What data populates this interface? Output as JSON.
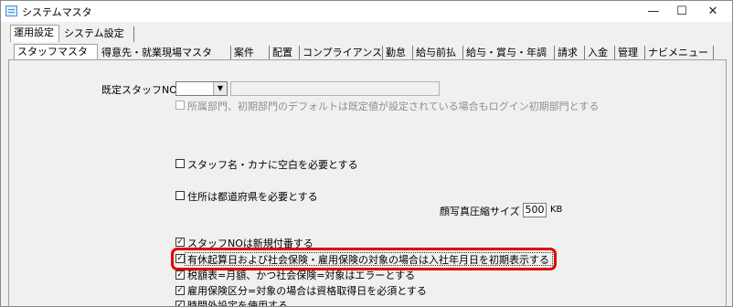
{
  "window": {
    "title": "システムマスタ",
    "minimize_glyph": "—",
    "maximize_glyph": "☐",
    "close_glyph": "✕"
  },
  "top_tabs": [
    {
      "label": "運用設定",
      "active": true
    },
    {
      "label": "システム設定",
      "active": false
    }
  ],
  "sub_tabs": [
    {
      "label": "スタッフマスタ",
      "active": true
    },
    {
      "label": "得意先・就業現場マスタ"
    },
    {
      "label": "案件"
    },
    {
      "label": "配置"
    },
    {
      "label": "コンプライアンス"
    },
    {
      "label": "勤怠"
    },
    {
      "label": "給与前払"
    },
    {
      "label": "給与・賞与・年調"
    },
    {
      "label": "請求"
    },
    {
      "label": "入金"
    },
    {
      "label": "管理"
    },
    {
      "label": "ナビメニュー"
    }
  ],
  "form": {
    "default_staff_label": "既定スタッフNO",
    "default_staff_value": "",
    "default_staff_name": "",
    "dept_default_label": "所属部門、初期部門のデフォルトは既定値が設定されている場合もログイン初期部門とする",
    "blank_name_label": "スタッフ名・カナに空白を必要とする",
    "prefecture_label": "住所は都道府県を必要とする",
    "photo_size_label": "顔写真圧縮サイズ",
    "photo_size_value": "500",
    "photo_size_unit": "KB",
    "auto_number_label": "スタッフNOは新規付番する",
    "leave_date_label": "有休起算日および社会保険・雇用保険の対象の場合は入社年月日を初期表示する",
    "tax_table_label": "税額表=月額、かつ社会保険=対象はエラーとする",
    "employment_ins_label": "雇用保険区分=対象の場合は資格取得日を必須とする",
    "overtime_label": "時間外設定を使用する"
  },
  "checkbox_states": {
    "dept_default": false,
    "blank_name": false,
    "prefecture": false,
    "auto_number": true,
    "leave_date": true,
    "tax_table": true,
    "employment_ins": true,
    "overtime": true
  },
  "colors": {
    "highlight": "#e00000"
  }
}
